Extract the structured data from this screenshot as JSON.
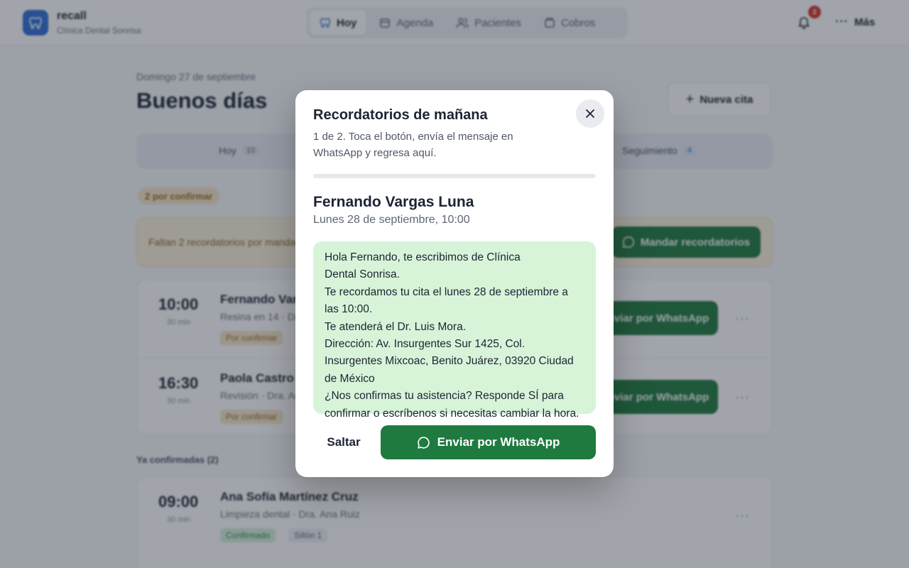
{
  "brand": {
    "name": "recall",
    "clinic": "Clínica Dental Sonrisa"
  },
  "nav": {
    "tabs": [
      {
        "label": "Hoy",
        "icon": "tooth-icon",
        "active": true
      },
      {
        "label": "Agenda",
        "icon": "calendar-icon",
        "active": false
      },
      {
        "label": "Pacientes",
        "icon": "users-icon",
        "active": false
      },
      {
        "label": "Cobros",
        "icon": "wallet-icon",
        "active": false
      }
    ],
    "notifications_count": "2",
    "more_label": "Más"
  },
  "main": {
    "date": "Domingo 27 de septiembre",
    "greeting": "Buenos días",
    "new_appointment_label": "Nueva cita",
    "segments": {
      "today_label": "Hoy",
      "today_count": "10",
      "followup_label": "Seguimiento",
      "followup_count": "4"
    },
    "pending_chip": "2 por confirmar",
    "banner": {
      "text": "Faltan 2 recordatorios por mandar",
      "button_label": "Mandar recordatorios"
    },
    "pending_appointments": [
      {
        "time": "10:00",
        "duration": "30 min",
        "name": "Fernando Vargas Luna",
        "detail": "Resina en 14 · Dr. Luis Mora",
        "status": "Por confirmar",
        "action": "Enviar por WhatsApp"
      },
      {
        "time": "16:30",
        "duration": "30 min",
        "name": "Paola Castro",
        "detail": "Revisión · Dra. Ana Ruiz",
        "status": "Por confirmar",
        "action": "Enviar por WhatsApp"
      }
    ],
    "confirmed_section_title": "Ya confirmadas (2)",
    "confirmed_appointments": [
      {
        "time": "09:00",
        "duration": "30 min",
        "name": "Ana Sofía Martínez Cruz",
        "detail": "Limpieza dental · Dra. Ana Ruiz",
        "status": "Confirmado",
        "extra": "Sillón 1"
      }
    ]
  },
  "modal": {
    "title": "Recordatorios de mañana",
    "subtitle": "1 de 2. Toca el botón, envía el mensaje en WhatsApp y regresa aquí.",
    "progress": 0,
    "patient_name": "Fernando Vargas Luna",
    "appointment_time": "Lunes 28 de septiembre, 10:00",
    "message": "Hola Fernando, te escribimos de Clínica\nDental Sonrisa.\nTe recordamos tu cita el lunes 28 de septiembre a las 10:00.\nTe atenderá el Dr. Luis Mora.\nDirección: Av. Insurgentes Sur 1425, Col. Insurgentes Mixcoac, Benito Juárez, 03920 Ciudad de México\n¿Nos confirmas tu asistencia? Responde SÍ para confirmar o escríbenos si necesitas cambiar la hora.",
    "skip_label": "Saltar",
    "send_label": "Enviar por WhatsApp"
  },
  "colors": {
    "brand_blue": "#2f6fd6",
    "whatsapp_green": "#1f7a3f",
    "message_bubble": "#d7f4d9",
    "pending": "#f6e7c9",
    "confirmed": "#d7f0de"
  }
}
